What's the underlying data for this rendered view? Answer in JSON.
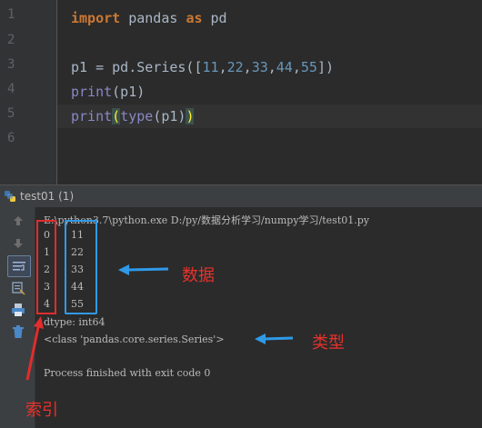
{
  "editor": {
    "line_numbers": [
      "1",
      "2",
      "3",
      "4",
      "5",
      "6"
    ],
    "lines": {
      "l1": {
        "kw1": "import",
        "mod": " pandas ",
        "kw2": "as",
        "alias": " pd"
      },
      "l3": {
        "pre": "p1 = pd.Series([",
        "n1": "11",
        "n2": "22",
        "n3": "33",
        "n4": "44",
        "n5": "55",
        "post": "])",
        "c1": ",",
        "c2": ",",
        "c3": ",",
        "c4": ","
      },
      "l4": {
        "fn": "print",
        "rest": "(p1)"
      },
      "l5": {
        "fn": "print",
        "open": "(",
        "fn2": "type",
        "mid": "(p1)",
        "close": ")"
      }
    }
  },
  "run_panel": {
    "tab_label": "test01 (1)",
    "console": {
      "command": "E:\\python3.7\\python.exe D:/py/数据分析学习/numpy学习/test01.py",
      "rows": [
        {
          "index": "0",
          "value": "11"
        },
        {
          "index": "1",
          "value": "22"
        },
        {
          "index": "2",
          "value": "33"
        },
        {
          "index": "3",
          "value": "44"
        },
        {
          "index": "4",
          "value": "55"
        }
      ],
      "dtype_line": "dtype: int64",
      "class_line": "<class 'pandas.core.series.Series'>",
      "finish_line": "Process finished with exit code 0"
    },
    "toolbar_icons": [
      "arrow-up-icon",
      "arrow-down-icon",
      "soft-wrap-icon",
      "scroll-to-end-icon",
      "print-icon",
      "trash-icon"
    ]
  },
  "annotations": {
    "data_label": "数据",
    "type_label": "类型",
    "index_label": "索引",
    "red_color": "#e02d2d",
    "blue_color": "#2f9ae8"
  }
}
